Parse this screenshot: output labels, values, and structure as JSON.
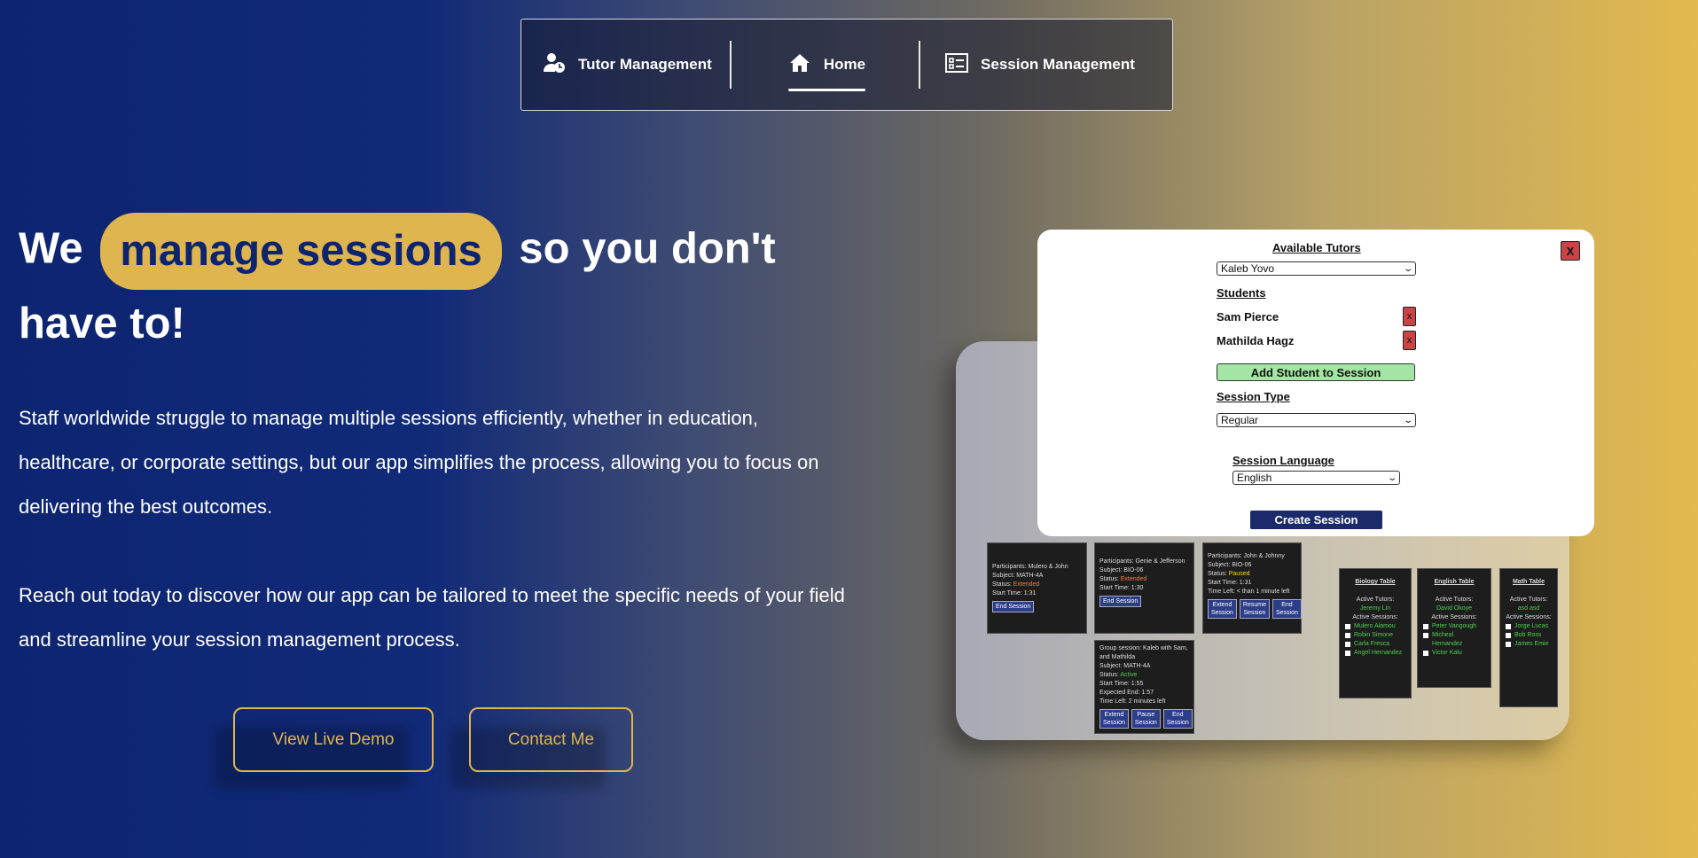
{
  "nav": {
    "items": [
      {
        "label": "Tutor Management",
        "icon": "user-clock-icon"
      },
      {
        "label": "Home",
        "icon": "home-icon",
        "active": true
      },
      {
        "label": "Session Management",
        "icon": "list-icon"
      }
    ]
  },
  "hero": {
    "title_pre": "We",
    "title_highlight": "manage sessions",
    "title_post": "so you don't have to!",
    "paragraph1": "Staff worldwide struggle to manage multiple sessions efficiently, whether in education, healthcare, or corporate settings, but our app simplifies the process, allowing you to focus on delivering the best outcomes.",
    "paragraph2": "Reach out today to discover how our app can be tailored to meet the specific needs of your field and streamline your session management process.",
    "buttons": {
      "demo": "View Live Demo",
      "contact": "Contact Me"
    }
  },
  "colors": {
    "accent": "#dfb54f",
    "navy": "#0d2570"
  },
  "mockup": {
    "modal": {
      "close": "X",
      "tutors_label": "Available Tutors",
      "tutor_selected": "Kaleb Yovo",
      "students_label": "Students",
      "students": [
        "Sam Pierce",
        "Mathilda Hagz"
      ],
      "student_remove": "x",
      "add_student": "Add Student to Session",
      "session_type_label": "Session Type",
      "session_type": "Regular",
      "language_label": "Session Language",
      "language": "English",
      "create": "Create Session"
    },
    "cards": [
      {
        "lines": [
          "Participants: Mulero & John",
          "Subject: MATH-4A"
        ],
        "status_prefix": "Status: ",
        "status": "Extended",
        "status_class": "st-ext",
        "tail": [
          "Start Time: 1:31"
        ],
        "buttons": [
          "End Session"
        ]
      },
      {
        "lines": [
          "Participants: Genie & Jefferson",
          "Subject: BIO-06"
        ],
        "status_prefix": "Status: ",
        "status": "Extended",
        "status_class": "st-ext",
        "tail": [
          "Start Time: 1:30"
        ],
        "buttons": [
          "End Session"
        ]
      },
      {
        "lines": [
          "Participants: John & Johnny",
          "Subject: BIO-06"
        ],
        "status_prefix": "Status: ",
        "status": "Paused",
        "status_class": "st-pau",
        "tail": [
          "Start Time: 1:31",
          "Time Left: < than 1 minute left"
        ],
        "buttons": [
          "Extend Session",
          "Resume Session",
          "End Session"
        ]
      },
      {
        "lines": [
          "Group session: Kaleb with Sam, and Mathilda",
          "Subject: MATH-4A"
        ],
        "status_prefix": "Status: ",
        "status": "Active",
        "status_class": "st-act",
        "tail": [
          "Start Time: 1:55",
          "Expected End: 1:57",
          "Time Left: 2 minutes left"
        ],
        "buttons": [
          "Extend Session",
          "Pause Session",
          "End Session"
        ]
      }
    ],
    "tables": [
      {
        "title": "Biology Table",
        "tutors_label": "Active Tutors:",
        "tutors": [
          "Jeremy Lin"
        ],
        "sessions_label": "Active Sessions:",
        "sessions": [
          "Mulero Alamou",
          "Robin Simone",
          "Carla Fresca",
          "Angel Hernandez"
        ]
      },
      {
        "title": "English Table",
        "tutors_label": "Active Tutors:",
        "tutors": [
          "David Okoye"
        ],
        "sessions_label": "Active Sessions:",
        "sessions": [
          "Peter Vangough",
          "Micheal Hernandez",
          "Victor Kalu"
        ]
      },
      {
        "title": "Math Table",
        "tutors_label": "Active Tutors:",
        "tutors": [
          "asd asd"
        ],
        "sessions_label": "Active Sessions:",
        "sessions": [
          "Jorge Lucas",
          "Bob Ross",
          "James Emie"
        ]
      }
    ]
  }
}
